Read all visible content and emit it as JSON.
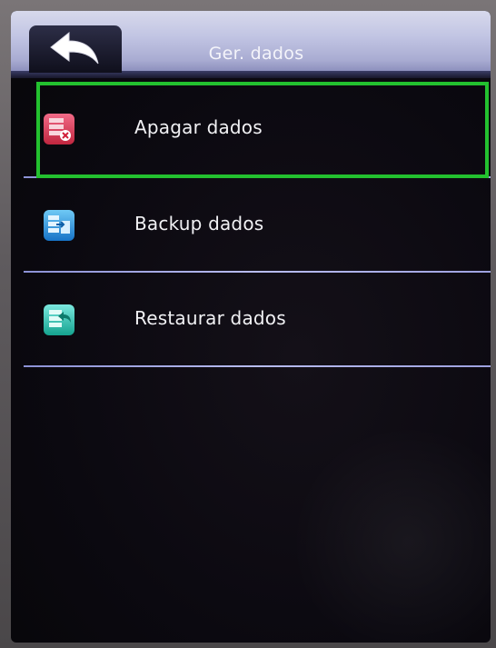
{
  "header": {
    "title": "Ger. dados",
    "back_icon": "back-arrow-icon"
  },
  "menu": {
    "items": [
      {
        "label": "Apagar dados",
        "icon": "delete-data-icon",
        "selected": true
      },
      {
        "label": "Backup dados",
        "icon": "backup-data-icon",
        "selected": false
      },
      {
        "label": "Restaurar dados",
        "icon": "restore-data-icon",
        "selected": false
      }
    ]
  },
  "colors": {
    "highlight": "#23c12f",
    "divider": "#a9aee8",
    "header": "#c1c4e3",
    "screen_bg": "#0b0910"
  }
}
